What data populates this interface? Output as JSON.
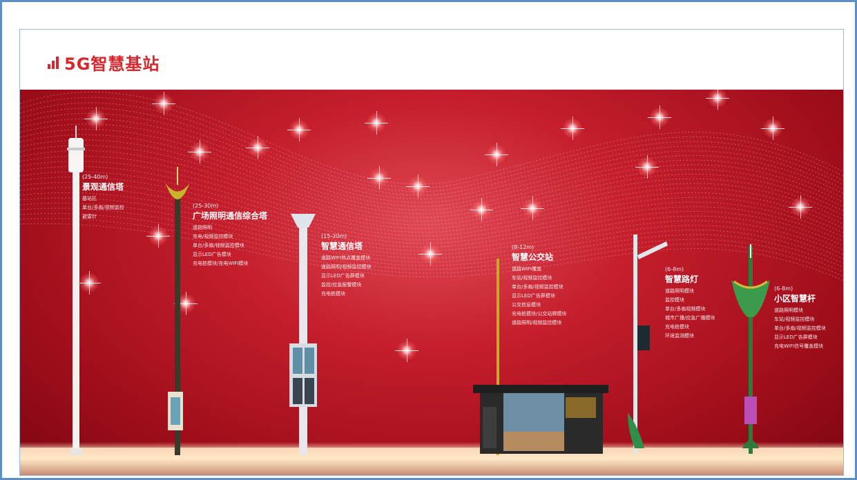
{
  "page": {
    "title": "5G智慧基站",
    "title_icon": "signal-bars-icon",
    "accent_color": "#d6272d",
    "frame_color": "#5d8fc7"
  },
  "banner": {
    "background": "red-gradient-with-sparkles",
    "towers": [
      {
        "height": "(25-40m)",
        "name": "景观通信塔",
        "features": [
          "基站区",
          "单台/多扇/视频监控",
          "避雷针"
        ]
      },
      {
        "height": "(25-30m)",
        "name": "广场照明通信综合塔",
        "features": [
          "道路照明",
          "充电/视频监控模块",
          "单台/多扇/视频监控模块",
          "显示LED广告模块",
          "充电桩模块/充电WIFI模块"
        ]
      },
      {
        "height": "(15-20m)",
        "name": "智慧通信塔",
        "features": [
          "道路WIFI热点覆盖模块",
          "道路照明/视频监控模块",
          "显示LED广告屏模块",
          "监控/应急报警模块",
          "充电桩模块"
        ]
      },
      {
        "height": "(8-12m)",
        "name": "智慧公交站",
        "features": [
          "道路WIFI覆盖",
          "车站/视频监控模块",
          "单台/多扇/视频监控模块",
          "显示LED广告屏模块",
          "公交信息模块",
          "充电桩模块/公交站牌模块",
          "道路照明/视频监控模块"
        ]
      },
      {
        "height": "(6-8m)",
        "name": "智慧路灯",
        "features": [
          "道路照明模块",
          "监控模块",
          "单台/多扇视频模块",
          "城市广播/应急广播模块",
          "充电桩模块",
          "环境监测模块"
        ]
      },
      {
        "height": "(6-8m)",
        "name": "小区智慧杆",
        "features": [
          "道路照明模块",
          "车站/视频监控模块",
          "单台/多扇/视频监控模块",
          "显示LED广告屏模块",
          "充电WIFI信号覆盖模块"
        ]
      }
    ]
  }
}
